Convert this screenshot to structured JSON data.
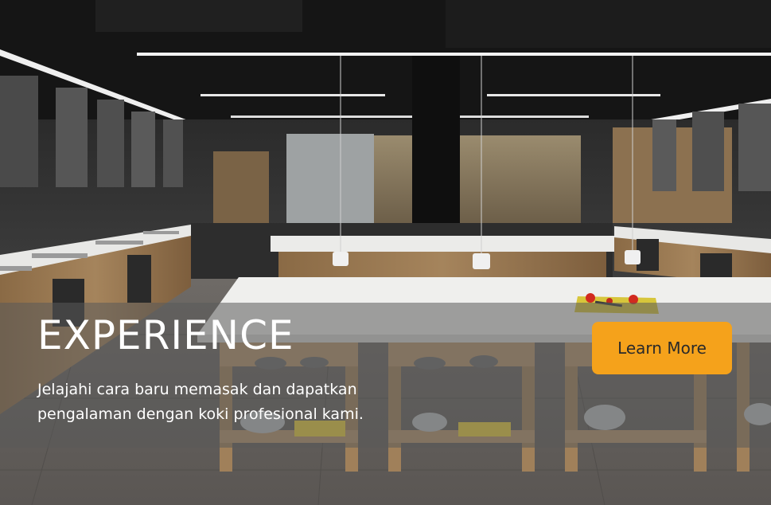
{
  "hero": {
    "headline": "EXPERIENCE",
    "description_lines": [
      "Jelajahi cara baru memasak dan dapatkan",
      "pengalaman dengan koki profesional kami."
    ],
    "cta_label": "Learn More"
  },
  "colors": {
    "cta_background": "#f5a21b",
    "cta_text": "#2a2a2a",
    "headline_text": "#ffffff",
    "overlay": "rgba(90,90,90,0.55)"
  }
}
